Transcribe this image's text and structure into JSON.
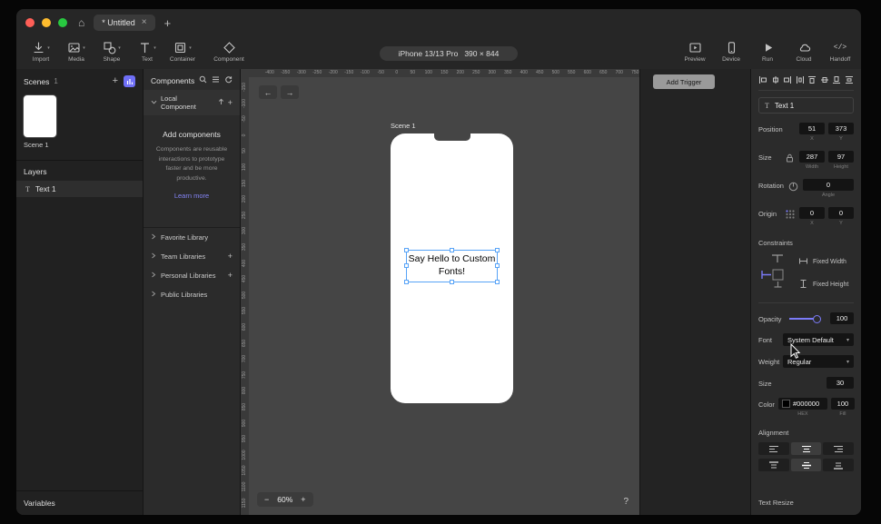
{
  "window": {
    "traffic": {
      "red": "#ff5f57",
      "yellow": "#febc2e",
      "green": "#28c840"
    }
  },
  "icons": {
    "home": "⌂",
    "close": "×",
    "new_tab": "+",
    "plus": "+",
    "caret_down": "▾",
    "back": "←",
    "forward": "→",
    "handoff": "</>",
    "t_glyph": "T"
  },
  "titlebar": {
    "tab_title": "* Untitled"
  },
  "toolbar": {
    "left": [
      {
        "label": "Import"
      },
      {
        "label": "Media"
      },
      {
        "label": "Shape"
      },
      {
        "label": "Text"
      },
      {
        "label": "Container"
      },
      {
        "label": "Component"
      }
    ],
    "device_pill": {
      "name": "iPhone 13/13 Pro",
      "size": "390 × 844"
    },
    "right": [
      {
        "label": "Preview"
      },
      {
        "label": "Device"
      },
      {
        "label": "Run"
      },
      {
        "label": "Cloud"
      },
      {
        "label": "Handoff"
      }
    ]
  },
  "scenes_panel": {
    "title": "Scenes",
    "count": "1",
    "scenes": [
      {
        "name": "Scene 1"
      }
    ],
    "layers_title": "Layers",
    "layers": [
      {
        "name": "Text 1"
      }
    ],
    "variables_label": "Variables"
  },
  "components_panel": {
    "title": "Components",
    "local_section": "Local Component",
    "empty_title": "Add components",
    "empty_body": "Components are reusable interactions to prototype faster and be more productive.",
    "learn_more": "Learn more",
    "libraries": [
      {
        "name": "Favorite Library"
      },
      {
        "name": "Team Libraries"
      },
      {
        "name": "Personal Libraries"
      },
      {
        "name": "Public Libraries"
      }
    ]
  },
  "canvas": {
    "scene_label": "Scene 1",
    "text_content": "Say Hello to Custom Fonts!",
    "zoom_out": "−",
    "zoom_level": "60%",
    "zoom_in": "+",
    "help": "?",
    "ruler_top": [
      "-400",
      "-350",
      "-300",
      "-250",
      "-200",
      "-150",
      "-100",
      "-50",
      "0",
      "50",
      "100",
      "150",
      "200",
      "250",
      "300",
      "350",
      "400",
      "450",
      "500",
      "550",
      "600",
      "650",
      "700",
      "750"
    ],
    "ruler_left": [
      "-150",
      "-100",
      "-50",
      "0",
      "50",
      "100",
      "150",
      "200",
      "250",
      "300",
      "350",
      "400",
      "450",
      "500",
      "550",
      "600",
      "650",
      "700",
      "750",
      "800",
      "850",
      "900",
      "950",
      "1000",
      "1050",
      "1100",
      "1150"
    ]
  },
  "trigger_panel": {
    "add_trigger_label": "Add Trigger"
  },
  "properties": {
    "layer_name": "Text 1",
    "position": {
      "label": "Position",
      "x": "51",
      "y": "373",
      "x_sub": "X",
      "y_sub": "Y"
    },
    "size": {
      "label": "Size",
      "width": "287",
      "height": "97",
      "width_sub": "Width",
      "height_sub": "Height"
    },
    "rotation": {
      "label": "Rotation",
      "angle": "0",
      "angle_sub": "Angle"
    },
    "origin": {
      "label": "Origin",
      "x": "0",
      "y": "0",
      "x_sub": "X",
      "y_sub": "Y"
    },
    "constraints": {
      "label": "Constraints",
      "fixed_width": "Fixed Width",
      "fixed_height": "Fixed Height"
    },
    "opacity": {
      "label": "Opacity",
      "value": "100"
    },
    "font": {
      "label": "Font",
      "value": "System Default"
    },
    "weight": {
      "label": "Weight",
      "value": "Regular"
    },
    "font_size": {
      "label": "Size",
      "value": "30"
    },
    "color": {
      "label": "Color",
      "hex": "#000000",
      "hex_sub": "HEX",
      "fill": "100",
      "fill_sub": "Fill"
    },
    "alignment_label": "Alignment",
    "text_resize_label": "Text Resize"
  },
  "colors": {
    "accent": "#7b7bf8",
    "selection": "#57a3f7"
  }
}
